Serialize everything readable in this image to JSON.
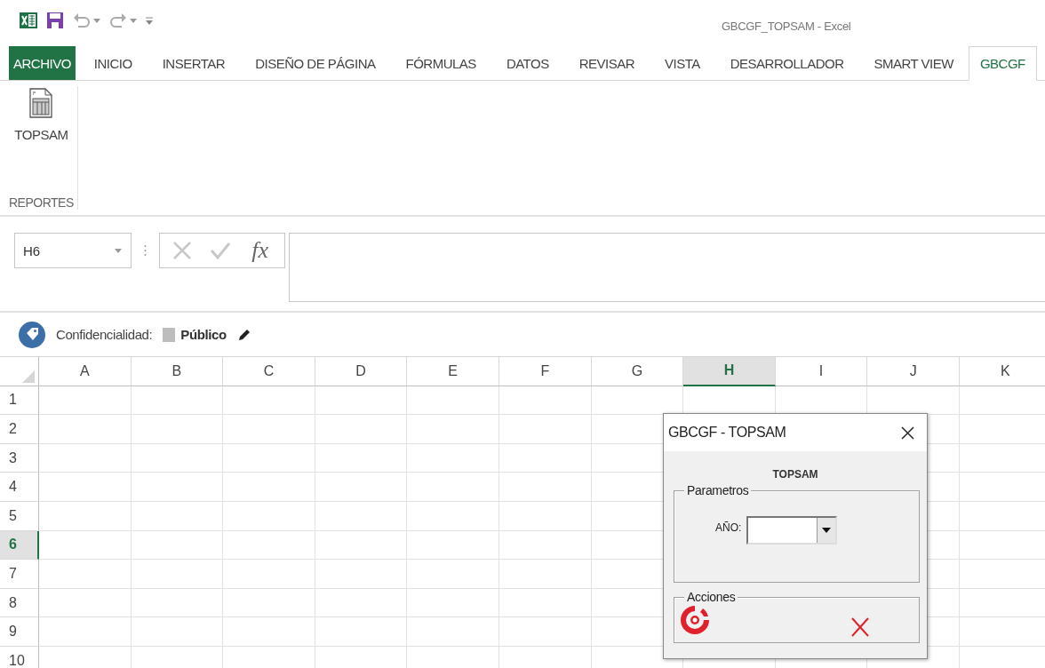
{
  "window": {
    "title": "GBCGF_TOPSAM - Excel"
  },
  "tabs": [
    {
      "label": "ARCHIVO",
      "kind": "file",
      "selected": false
    },
    {
      "label": "INICIO",
      "kind": "tab",
      "selected": false
    },
    {
      "label": "INSERTAR",
      "kind": "tab",
      "selected": false
    },
    {
      "label": "DISEÑO DE PÁGINA",
      "kind": "tab",
      "selected": false
    },
    {
      "label": "FÓRMULAS",
      "kind": "tab",
      "selected": false
    },
    {
      "label": "DATOS",
      "kind": "tab",
      "selected": false
    },
    {
      "label": "REVISAR",
      "kind": "tab",
      "selected": false
    },
    {
      "label": "VISTA",
      "kind": "tab",
      "selected": false
    },
    {
      "label": "DESARROLLADOR",
      "kind": "tab",
      "selected": false
    },
    {
      "label": "SMART VIEW",
      "kind": "tab",
      "selected": false
    },
    {
      "label": "GBCGF",
      "kind": "tab",
      "selected": true
    }
  ],
  "ribbon": {
    "groups": [
      {
        "label": "REPORTES",
        "buttons": [
          {
            "label": "TOPSAM"
          }
        ]
      }
    ]
  },
  "formula_bar": {
    "name_box": "H6",
    "function_button": "fx"
  },
  "classification": {
    "label": "Confidencialidad:",
    "value": "Público"
  },
  "sheet": {
    "columns": [
      {
        "label": "A",
        "selected": false
      },
      {
        "label": "B",
        "selected": false
      },
      {
        "label": "C",
        "selected": false
      },
      {
        "label": "D",
        "selected": false
      },
      {
        "label": "E",
        "selected": false
      },
      {
        "label": "F",
        "selected": false
      },
      {
        "label": "G",
        "selected": false
      },
      {
        "label": "H",
        "selected": true
      },
      {
        "label": "I",
        "selected": false
      },
      {
        "label": "J",
        "selected": false
      },
      {
        "label": "K",
        "selected": false
      }
    ],
    "rows": [
      {
        "label": "1",
        "selected": false
      },
      {
        "label": "2",
        "selected": false
      },
      {
        "label": "3",
        "selected": false
      },
      {
        "label": "4",
        "selected": false
      },
      {
        "label": "5",
        "selected": false
      },
      {
        "label": "6",
        "selected": true
      },
      {
        "label": "7",
        "selected": false
      },
      {
        "label": "8",
        "selected": false
      },
      {
        "label": "9",
        "selected": false
      },
      {
        "label": "10",
        "selected": false
      }
    ]
  },
  "dialog": {
    "title": "GBCGF - TOPSAM",
    "heading": "TOPSAM",
    "parameters": {
      "legend": "Parametros",
      "field_label": "AÑO:"
    },
    "actions": {
      "legend": "Acciones"
    }
  }
}
